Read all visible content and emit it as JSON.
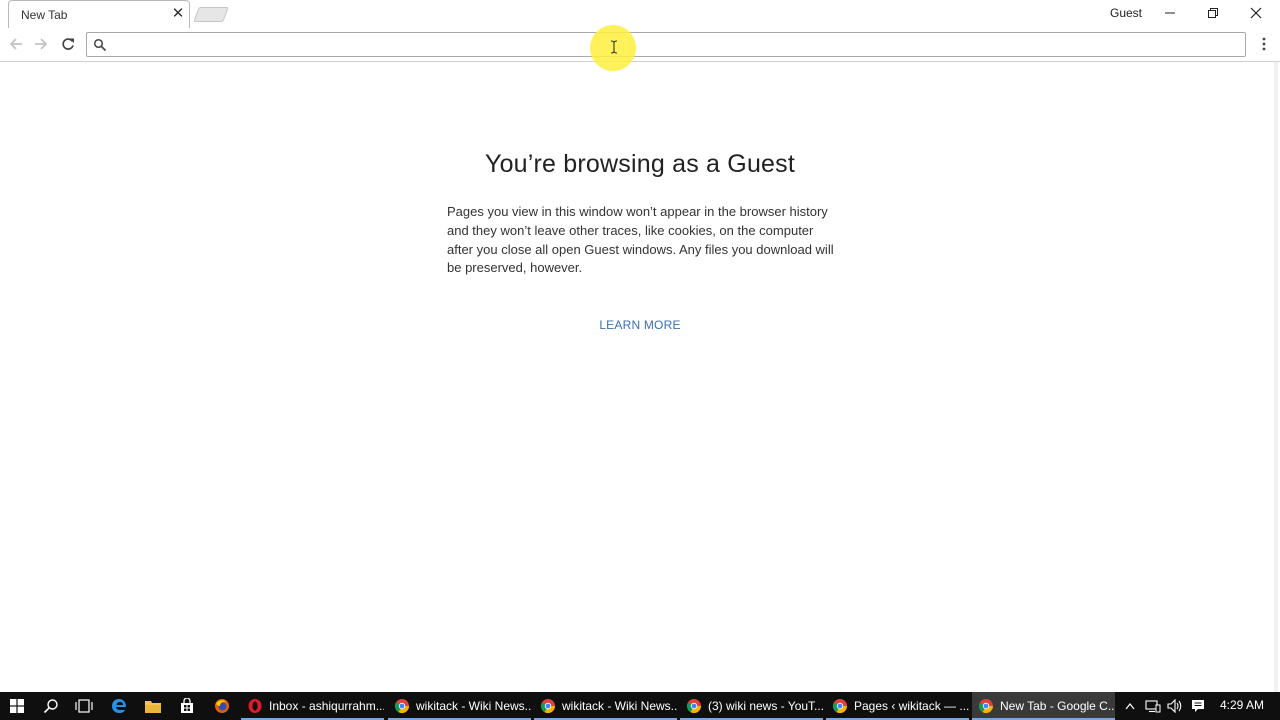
{
  "browser": {
    "tab_title": "New Tab",
    "profile_label": "Guest",
    "omnibox_value": "",
    "omnibox_placeholder": ""
  },
  "page": {
    "title": "You’re browsing as a Guest",
    "description": "Pages you view in this window won’t appear in the browser history and they won’t leave other traces, like cookies, on the computer after you close all open Guest windows. Any files you download will be preserved, however.",
    "learn_more": "LEARN MORE"
  },
  "taskbar": {
    "apps": [
      {
        "icon": "opera-icon",
        "label": "Inbox - ashiqurrahm..."
      },
      {
        "icon": "chrome-icon",
        "label": "wikitack - Wiki News..."
      },
      {
        "icon": "chrome-icon",
        "label": "wikitack - Wiki News..."
      },
      {
        "icon": "chrome-icon",
        "label": "(3) wiki news - YouT..."
      },
      {
        "icon": "chrome-icon",
        "label": "Pages ‹ wikitack — ..."
      },
      {
        "icon": "chrome-icon",
        "label": "New Tab - Google C..."
      }
    ],
    "clock": "4:29 AM"
  },
  "colors": {
    "link": "#3b6fb5",
    "taskbar": "#0f0f0f",
    "cursor_highlight": "#ffee3c"
  }
}
